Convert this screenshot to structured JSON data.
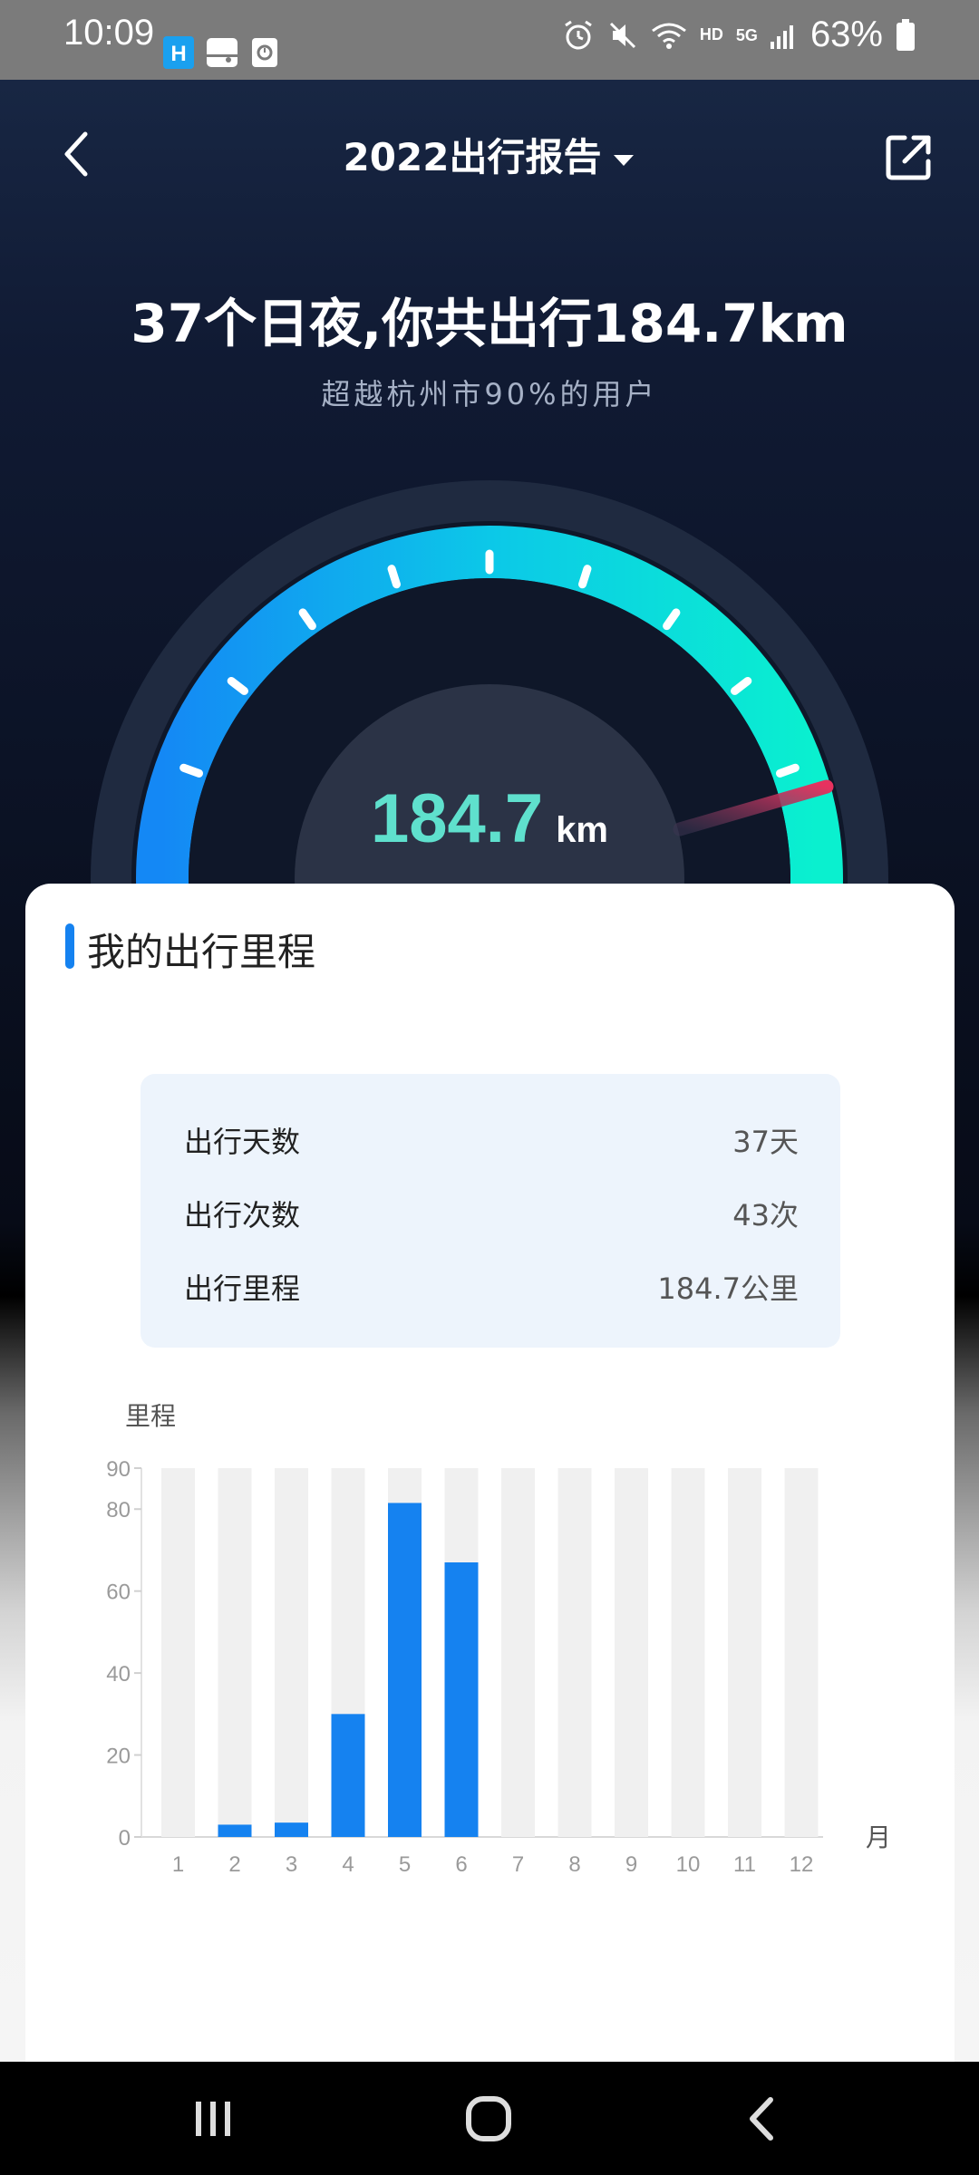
{
  "status_bar": {
    "time": "10:09",
    "battery": "63%",
    "hd": "HD",
    "network": "5G"
  },
  "header": {
    "title": "2022出行报告",
    "back_icon": "chevron-left-icon",
    "share_icon": "external-link-icon",
    "dropdown_icon": "caret-down-icon"
  },
  "summary": {
    "headline": "37个日夜,你共出行184.7km",
    "subline": "超越杭州市90%的用户"
  },
  "gauge": {
    "value": "184.7",
    "unit": "km",
    "colors": {
      "start": "#1488f5",
      "end": "#0af0cf",
      "needle": "#e7325f"
    }
  },
  "card": {
    "title": "我的出行里程",
    "stats": [
      {
        "label": "出行天数",
        "value": "37天"
      },
      {
        "label": "出行次数",
        "value": "43次"
      },
      {
        "label": "出行里程",
        "value": "184.7公里"
      }
    ]
  },
  "chart_data": {
    "type": "bar",
    "ylabel": "里程",
    "xlabel": "月",
    "categories": [
      "1",
      "2",
      "3",
      "4",
      "5",
      "6",
      "7",
      "8",
      "9",
      "10",
      "11",
      "12"
    ],
    "values": [
      0,
      3,
      3.5,
      30,
      81.5,
      67,
      0,
      0,
      0,
      0,
      0,
      0
    ],
    "yticks": [
      0,
      20,
      40,
      60,
      80,
      90
    ],
    "ylim": [
      0,
      90
    ],
    "bar_color": "#1582f0",
    "background_bar_color": "#f0f0f0"
  }
}
